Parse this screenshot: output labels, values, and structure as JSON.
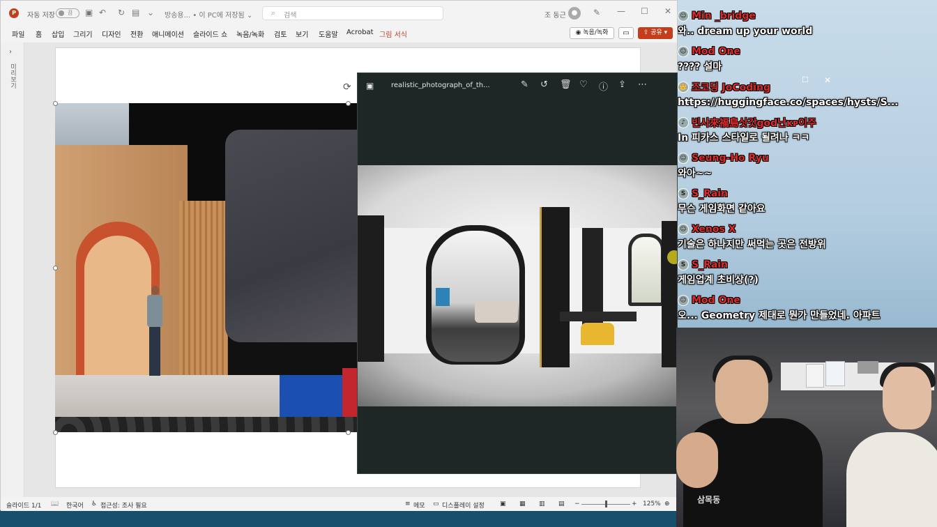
{
  "ppt": {
    "logo": "P",
    "autosave_label": "자동 저장",
    "autosave_toggle": "끔",
    "doc_name": "방송용... • 이 PC에 저장됨 ⌄",
    "search_placeholder": "검색",
    "user_name": "조 동근",
    "menu": [
      "파일",
      "홈",
      "삽입",
      "그리기",
      "디자인",
      "전환",
      "애니메이션",
      "슬라이드 쇼",
      "녹음/녹화",
      "검토",
      "보기",
      "도움말",
      "Acrobat",
      "그림 서식"
    ],
    "record_label": "녹음/녹화",
    "share_label": "공유",
    "thumb_label": "미리보기",
    "status": {
      "slide": "슬라이드 1/1",
      "lang": "한국어",
      "access": "접근성: 조사 필요",
      "notes": "메모",
      "display": "디스플레이 설정",
      "zoom": "125%"
    }
  },
  "photos": {
    "filename": "realistic_photograph_of_th..."
  },
  "chat": [
    {
      "name": "Min _bridge",
      "text": "와.. dream up your world",
      "badge": "☺"
    },
    {
      "name": "Mod One",
      "text": "???? 설마",
      "badge": "☺"
    },
    {
      "name": "조코딩 JoCoding",
      "text": "https://huggingface.co/spaces/hysts/S...",
      "badge": "👑"
    },
    {
      "name": "빈사來福島삿갓god난ĸᴘ이주",
      "text": "In 피카스 스타일로 될려나 ㅋㅋ",
      "badge": "♪"
    },
    {
      "name": "Seung-Ho Ryu",
      "text": "와아~~",
      "badge": "☺"
    },
    {
      "name": "S_Rain",
      "text": "무슨 게임화면 같아요",
      "badge": "S"
    },
    {
      "name": "Xenos X",
      "text": "기술은 하나지만 써먹는 곳은 전방위",
      "badge": "☺"
    },
    {
      "name": "S_Rain",
      "text": "게임업계 초비상(?)",
      "badge": "S"
    },
    {
      "name": "Mod One",
      "text": "오... Geometry 제대로 뭔가 만들었네. 아파트",
      "badge": "☺"
    }
  ],
  "webcam": {
    "shirt_text": "삼목동"
  },
  "colors": {
    "accent": "#c43e1c",
    "chat_name": "#e02a2a"
  }
}
